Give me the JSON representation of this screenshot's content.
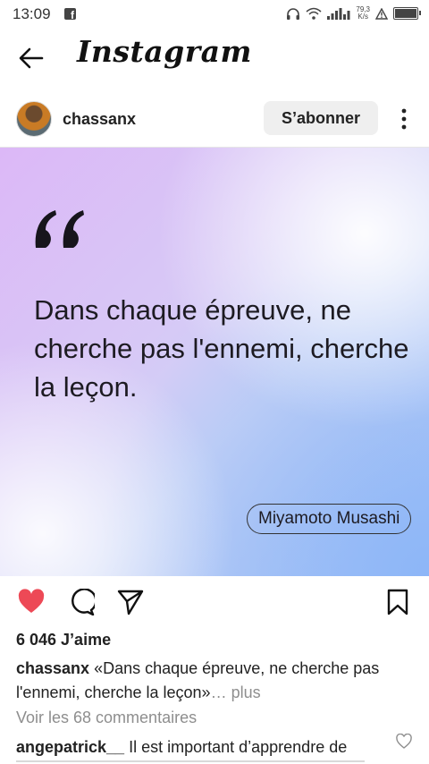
{
  "status_bar": {
    "time": "13:09",
    "speed_value": "79,3",
    "speed_unit": "K/s"
  },
  "header": {
    "title": "Instagram",
    "back_icon": "arrow-left-icon"
  },
  "post": {
    "username": "chassanx",
    "subscribe_label": "S’abonner",
    "more_icon": "vertical-dots-icon",
    "quote_text": "Dans chaque épreuve, ne cherche pas l'ennemi, cherche la leçon.",
    "author": "Miyamoto Musashi",
    "liked": true,
    "like_color": "#ed4956",
    "likes": "6 046 J’aime",
    "caption_user": "chassanx",
    "caption_text": "«Dans chaque épreuve, ne cherche pas l'ennemi, cherche la leçon»",
    "caption_more": "… plus",
    "view_comments": "Voir les 68 commentaires",
    "comment_user": "angepatrick__",
    "comment_text": "Il est important d’apprendre de"
  }
}
